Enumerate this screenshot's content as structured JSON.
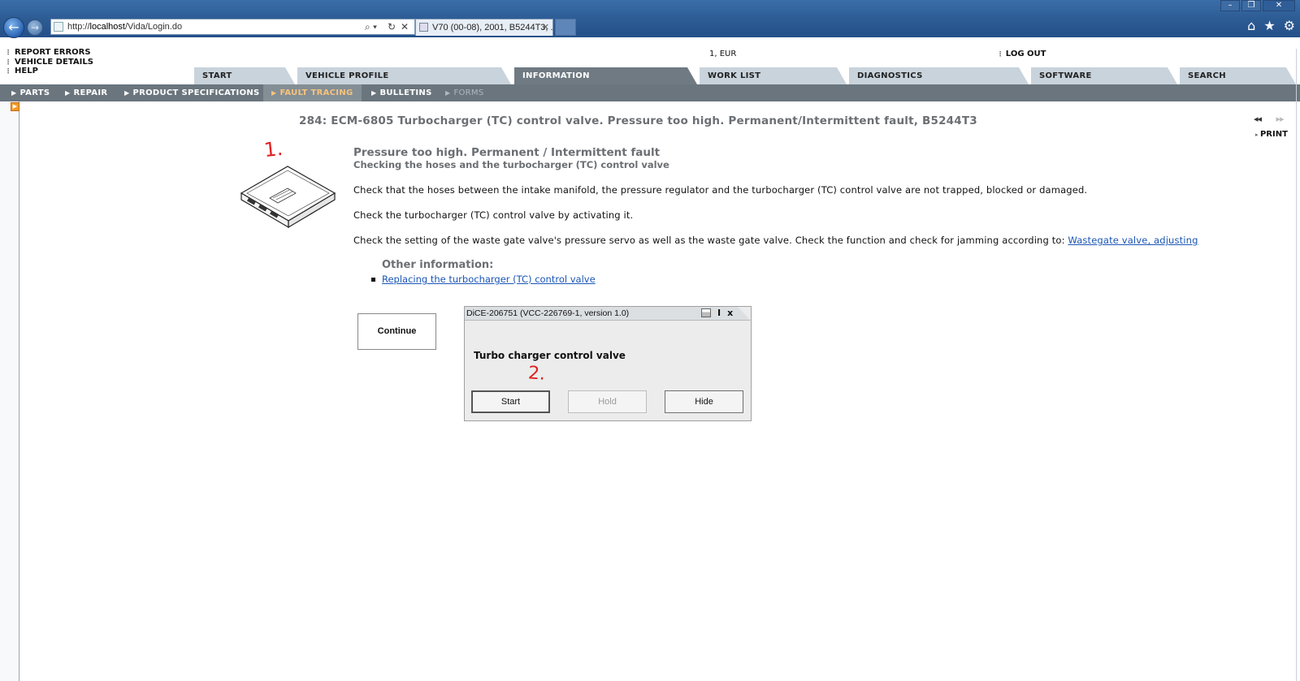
{
  "browser": {
    "address_prefix": "http://",
    "address_host": "localhost",
    "address_path": "/Vida/Login.do",
    "tab_title": "V70 (00-08), 2001, B5244T3, ...",
    "search_glyph": "⌕ ▾",
    "refresh_glyph": "↻",
    "stop_glyph": "✕",
    "tab_close": "✕",
    "minimize": "–",
    "restore": "❐",
    "close": "✕",
    "home_icon": "⌂",
    "favorites_icon": "★",
    "tools_icon": "⚙"
  },
  "header": {
    "links": [
      "REPORT ERRORS",
      "VEHICLE DETAILS",
      "HELP"
    ],
    "account": "1, EUR",
    "logout": "LOG OUT"
  },
  "main_tabs": [
    "START",
    "VEHICLE PROFILE",
    "INFORMATION",
    "WORK LIST",
    "DIAGNOSTICS",
    "SOFTWARE",
    "SEARCH"
  ],
  "active_main_tab": "INFORMATION",
  "sub_nav": [
    "PARTS",
    "REPAIR",
    "PRODUCT SPECIFICATIONS",
    "FAULT TRACING",
    "BULLETINS",
    "FORMS"
  ],
  "active_sub_nav": "FAULT TRACING",
  "document": {
    "title": "284: ECM-6805 Turbocharger (TC) control valve. Pressure too high. Permanent/Intermittent fault, B5244T3",
    "pager_back": "◂◂",
    "pager_forward": "▸▸",
    "print": "PRINT",
    "heading": "Pressure too high. Permanent / Intermittent fault",
    "subheading": "Checking the hoses and the turbocharger (TC) control valve",
    "para1": "Check that the hoses between the intake manifold, the pressure regulator and the turbocharger (TC) control valve are not trapped, blocked or damaged.",
    "para2": "Check the turbocharger (TC) control valve by activating it.",
    "para3_text": "Check the setting of the waste gate valve's pressure servo as well as the waste gate valve. Check the function and check for jamming according to:",
    "para3_link": "Wastegate valve, adjusting",
    "other_info_heading": "Other information:",
    "other_info_link": "Replacing the turbocharger (TC) control valve",
    "continue_label": "Continue"
  },
  "annotations": {
    "one": "1.",
    "two": "2."
  },
  "dialog": {
    "title": "DiCE-206751   (VCC-226769-1, version 1.0)",
    "info_label": "I",
    "close_label": "x",
    "label": "Turbo charger control valve",
    "start": "Start",
    "hold": "Hold",
    "hide": "Hide"
  },
  "colors": {
    "active_sub_text": "#f6c37c",
    "link": "#1a55b5",
    "annotation": "#e02020"
  }
}
